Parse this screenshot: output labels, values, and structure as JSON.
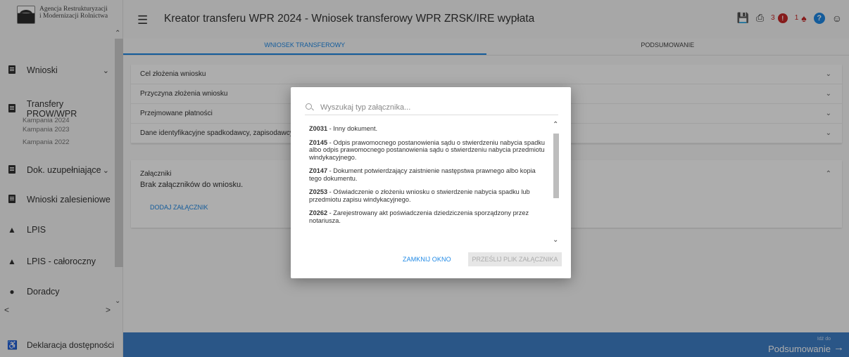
{
  "sidebar": {
    "logo_line1": "Agencja Restrukturyzacji",
    "logo_line2": "i Modernizacji Rolnictwa",
    "items": [
      {
        "label": "Wnioski"
      },
      {
        "label": "Transfery PROW/WPR"
      },
      {
        "label": "Dok. uzupełniające"
      },
      {
        "label": "Wnioski zalesieniowe"
      },
      {
        "label": "LPIS"
      },
      {
        "label": "LPIS - całoroczny"
      },
      {
        "label": "Doradcy"
      }
    ],
    "subitems": [
      "Kampania 2024",
      "Kampania 2023",
      "Kampania 2022"
    ],
    "accessibility": "Deklaracja dostępności"
  },
  "header": {
    "title": "Kreator transferu WPR 2024 - Wniosek transferowy WPR ZRSK/IRE wypłata",
    "badge_count_1": "3",
    "badge_count_2": "1"
  },
  "tabs": [
    "WNIOSEK TRANSFEROWY",
    "PODSUMOWANIE"
  ],
  "panels": [
    "Cel złożenia wniosku",
    "Przyczyna złożenia wniosku",
    "Przejmowane płatności",
    "Dane identyfikacyjne spadkodawcy, zapisodawcy"
  ],
  "attachments": {
    "title": "Załączniki",
    "empty": "Brak załączników do wniosku.",
    "add": "DODAJ ZAŁĄCZNIK"
  },
  "footer": {
    "small": "Idź do",
    "big": "Podsumowanie"
  },
  "dialog": {
    "search_placeholder": "Wyszukaj typ załącznika...",
    "items": [
      {
        "code": "Z0031",
        "text": " - Inny dokument."
      },
      {
        "code": "Z0145",
        "text": " - Odpis prawomocnego postanowienia sądu o stwierdzeniu nabycia spadku albo odpis prawomocnego postanowienia sądu o stwierdzeniu nabycia przedmiotu windykacyjnego."
      },
      {
        "code": "Z0147",
        "text": " - Dokument potwierdzający zaistnienie następstwa prawnego albo kopia tego dokumentu."
      },
      {
        "code": "Z0253",
        "text": " - Oświadczenie o złożeniu wniosku o stwierdzenie nabycia spadku lub przedmiotu zapisu windykacyjnego."
      },
      {
        "code": "Z0262",
        "text": " - Zarejestrowany akt poświadczenia dziedziczenia sporządzony przez notariusza."
      }
    ],
    "close_label": "ZAMKNIJ OKNO",
    "send_label": "PRZEŚLIJ PLIK ZAŁĄCZNIKA"
  }
}
